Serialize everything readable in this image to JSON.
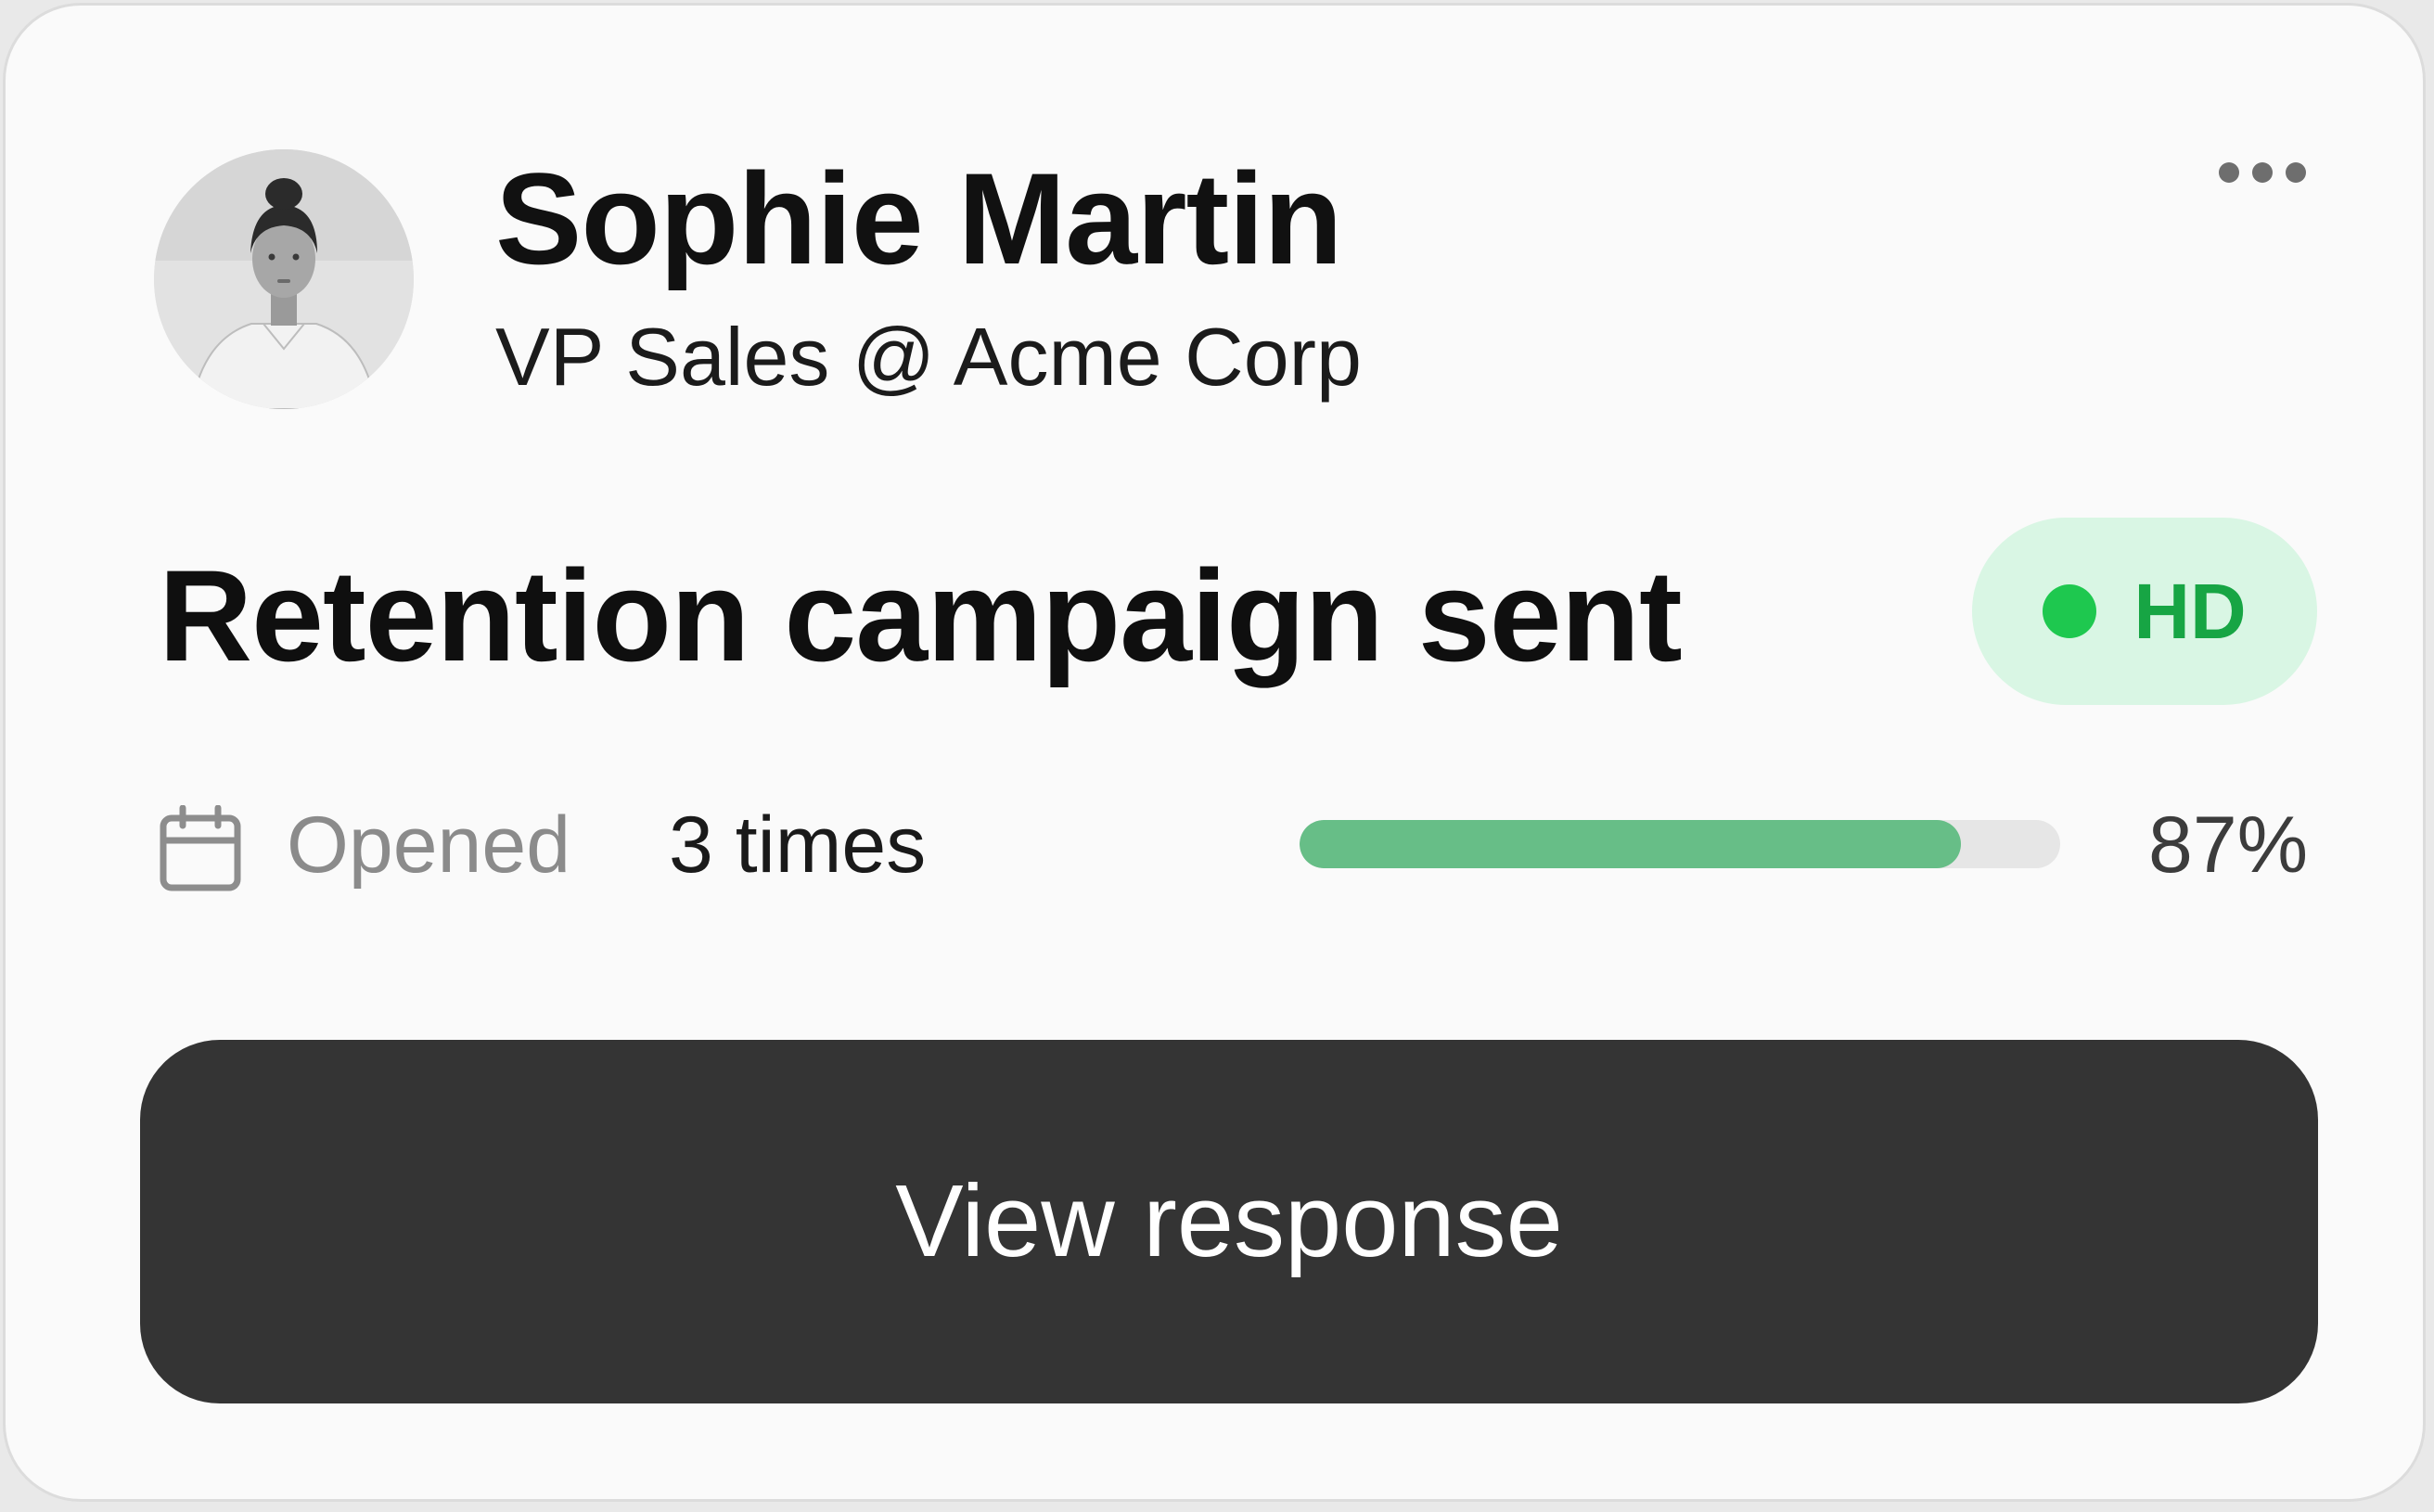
{
  "contact": {
    "name": "Sophie Martin",
    "role": "VP Sales @ Acme Corp",
    "avatar_icon": "person-photo"
  },
  "menu": {
    "icon": "more-horizontal-icon"
  },
  "activity": {
    "headline": "Retention campaign sent",
    "badge": {
      "label": "HD",
      "dot_color": "#1ec84f",
      "bg_color": "#d9f6e4",
      "text_color": "#17a544"
    }
  },
  "engagement": {
    "icon": "calendar-icon",
    "opened_label": "Opened",
    "opened_value": "3 times",
    "progress_percent": 87,
    "progress_label": "87%",
    "progress_color": "#67be87"
  },
  "action": {
    "button_label": "View response",
    "button_color": "#343434"
  }
}
